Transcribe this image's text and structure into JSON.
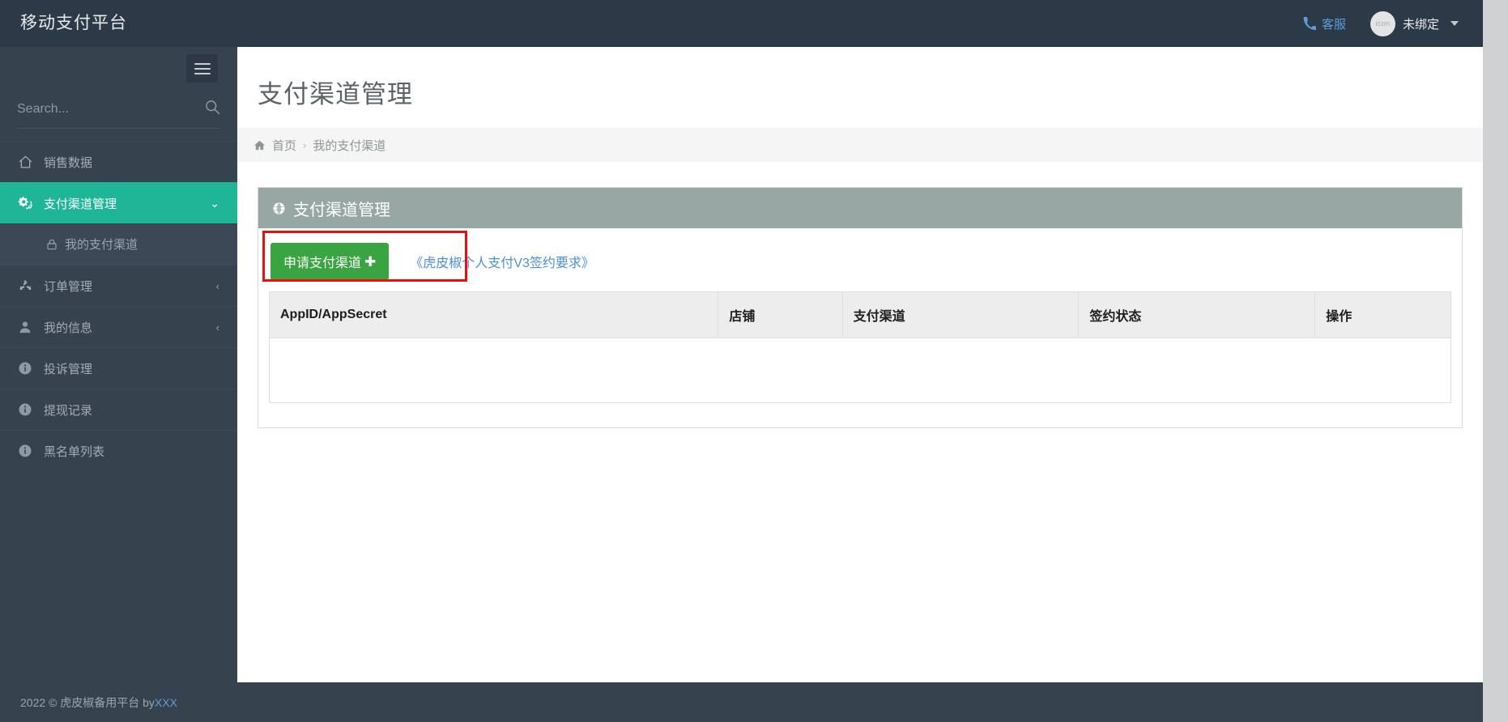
{
  "header": {
    "brand": "移动支付平台",
    "support": {
      "label": "客服",
      "icon": "phone-icon"
    },
    "user": {
      "avatar_text": "icon",
      "name": "未绑定",
      "caret": "chevron-down-icon"
    }
  },
  "sidebar": {
    "menu_toggle_icon": "hamburger-icon",
    "search": {
      "placeholder": "Search...",
      "value": "",
      "icon": "search-icon"
    },
    "items": [
      {
        "label": "销售数据",
        "icon": "home-icon",
        "active": false,
        "arrow": ""
      },
      {
        "label": "支付渠道管理",
        "icon": "gears-icon",
        "active": true,
        "arrow": "⌄"
      },
      {
        "label": "订单管理",
        "icon": "recycle-icon",
        "active": false,
        "arrow": "‹"
      },
      {
        "label": "我的信息",
        "icon": "user-icon",
        "active": false,
        "arrow": "‹"
      },
      {
        "label": "投诉管理",
        "icon": "info-circle-icon",
        "active": false,
        "arrow": ""
      },
      {
        "label": "提现记录",
        "icon": "info-circle-icon",
        "active": false,
        "arrow": ""
      },
      {
        "label": "黑名单列表",
        "icon": "info-circle-icon",
        "active": false,
        "arrow": ""
      }
    ],
    "sub_item": {
      "label": "我的支付渠道",
      "icon": "lock-icon"
    }
  },
  "footer": {
    "text": "2022 © 虎皮椒备用平台 by ",
    "link": "XXX"
  },
  "main": {
    "page_title": "支付渠道管理",
    "breadcrumb": {
      "home_icon": "home-icon",
      "home": "首页",
      "separator": "›",
      "current": "我的支付渠道"
    },
    "panel": {
      "header_icon": "globe-icon",
      "header_title": "支付渠道管理",
      "apply_button": "申请支付渠道",
      "apply_button_plus": "✚",
      "agreement_link": "《虎皮椒个人支付V3签约要求》"
    },
    "table": {
      "columns": [
        "AppID/AppSecret",
        "店铺",
        "支付渠道",
        "签约状态",
        "操作"
      ],
      "rows": []
    }
  },
  "colors": {
    "header_bg": "#2c3a47",
    "sidebar_bg": "#36434f",
    "accent_teal": "#1fb698",
    "panel_head_bg": "#97a8a4",
    "apply_green": "#3aa442",
    "link_blue": "#4a90d9",
    "highlight_red": "#e8100f"
  }
}
